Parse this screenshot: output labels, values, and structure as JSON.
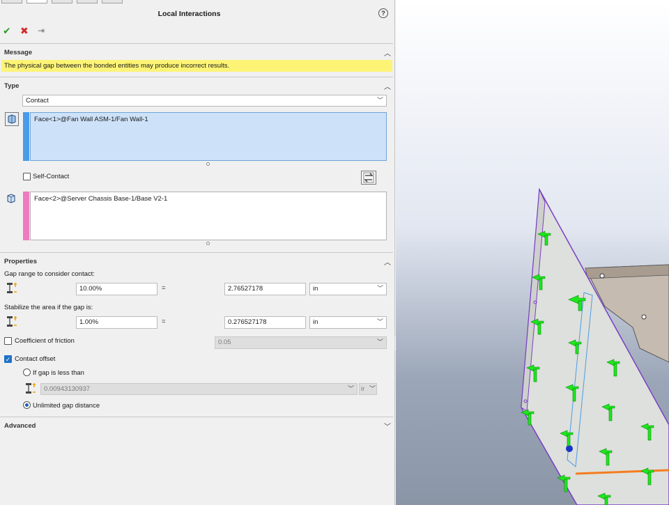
{
  "panel": {
    "title": "Local Interactions",
    "help_icon": "?"
  },
  "actions": {
    "ok": "✔",
    "cancel": "✖",
    "pin": "⇥"
  },
  "message": {
    "title": "Message",
    "text": "The physical gap between the bonded entities may produce incorrect results."
  },
  "type": {
    "title": "Type",
    "selected": "Contact",
    "set1": "Face<1>@Fan Wall ASM-1/Fan Wall-1",
    "self_contact": "Self-Contact",
    "set2": "Face<2>@Server Chassis Base-1/Base V2-1"
  },
  "properties": {
    "title": "Properties",
    "gap_label": "Gap range to consider contact:",
    "gap_percent": "10.00%",
    "gap_eq": "=",
    "gap_value": "2.76527178",
    "gap_unit": "in",
    "stabilize_label": "Stabilize the area if the gap is:",
    "stab_percent": "1.00%",
    "stab_eq": "=",
    "stab_value": "0.276527178",
    "stab_unit": "in",
    "friction_label": "Coefficient of friction",
    "friction_value": "0.05",
    "offset_label": "Contact offset",
    "if_gap_label": "If gap is less than",
    "if_gap_value": "0.00943130937",
    "if_gap_unit": "ir",
    "unlimited_label": "Unlimited gap distance"
  },
  "advanced": {
    "title": "Advanced"
  },
  "colors": {
    "ok": "#2e9b2e",
    "cancel": "#d42a2a",
    "message_bg": "#fdf476",
    "set1_stripe": "#4a9be8",
    "set2_stripe": "#f07ac0",
    "model_edge": "#7a3fc2",
    "arrows": "#1ee61e",
    "orange_edge": "#f57c1f"
  }
}
